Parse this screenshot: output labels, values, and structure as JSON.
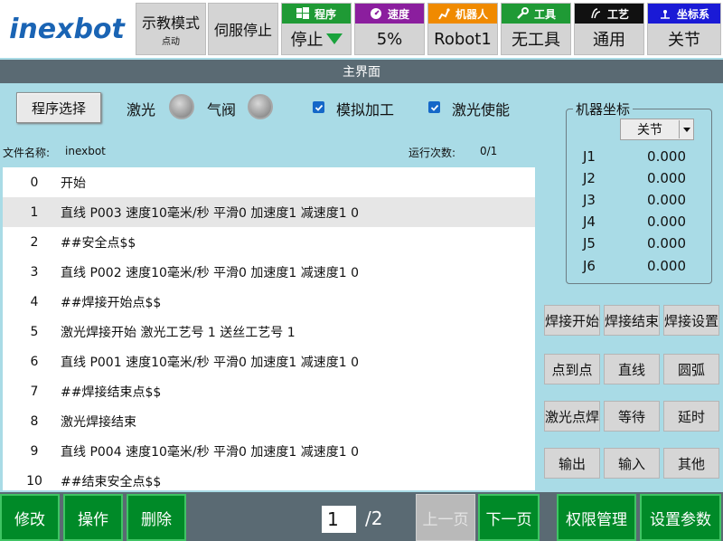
{
  "header": {
    "logo_text": "inexbot",
    "mode": {
      "label": "示教模式",
      "sub": "点动"
    },
    "servo_label": "伺服停止",
    "statuses": [
      {
        "label": "程序",
        "value": "停止",
        "color": "#1f9a35",
        "icon": "windows-grid-icon"
      },
      {
        "label": "速度",
        "value": "5%",
        "color": "#8b1e9e",
        "icon": "speed-gauge-icon"
      },
      {
        "label": "机器人",
        "value": "Robot1",
        "color": "#f08a00",
        "icon": "robot-arm-icon"
      },
      {
        "label": "工具",
        "value": "无工具",
        "color": "#1f9a35",
        "icon": "wrench-icon"
      },
      {
        "label": "工艺",
        "value": "通用",
        "color": "#111111",
        "icon": "process-icon"
      },
      {
        "label": "坐标系",
        "value": "关节",
        "color": "#1a1ad6",
        "icon": "coordinate-icon"
      }
    ]
  },
  "title": "主界面",
  "controls": {
    "program_select": "程序选择",
    "laser_label": "激光",
    "valve_label": "气阀",
    "simulate_label": "模拟加工",
    "laser_enable_label": "激光使能"
  },
  "file": {
    "name_label": "文件名称:",
    "name_value": "inexbot",
    "runs_label": "运行次数:",
    "runs_value": "0/1"
  },
  "program_lines": [
    {
      "num": "0",
      "text": "开始"
    },
    {
      "num": "1",
      "text": "直线 P003 速度10毫米/秒  平滑0 加速度1 减速度1 0"
    },
    {
      "num": "2",
      "text": "##安全点$$"
    },
    {
      "num": "3",
      "text": "直线 P002 速度10毫米/秒  平滑0 加速度1 减速度1 0"
    },
    {
      "num": "4",
      "text": "##焊接开始点$$"
    },
    {
      "num": "5",
      "text": "激光焊接开始 激光工艺号 1 送丝工艺号 1"
    },
    {
      "num": "6",
      "text": "直线 P001 速度10毫米/秒  平滑0 加速度1 减速度1 0"
    },
    {
      "num": "7",
      "text": "##焊接结束点$$"
    },
    {
      "num": "8",
      "text": "激光焊接结束"
    },
    {
      "num": "9",
      "text": "直线 P004 速度10毫米/秒  平滑0 加速度1 减速度1 0"
    },
    {
      "num": "10",
      "text": "##结束安全点$$"
    }
  ],
  "coords": {
    "title": "机器坐标",
    "mode": "关节",
    "joints": [
      {
        "name": "J1",
        "value": "0.000"
      },
      {
        "name": "J2",
        "value": "0.000"
      },
      {
        "name": "J3",
        "value": "0.000"
      },
      {
        "name": "J4",
        "value": "0.000"
      },
      {
        "name": "J5",
        "value": "0.000"
      },
      {
        "name": "J6",
        "value": "0.000"
      }
    ]
  },
  "functions": [
    "焊接开始",
    "焊接结束",
    "焊接设置",
    "点到点",
    "直线",
    "圆弧",
    "激光点焊",
    "等待",
    "延时",
    "输出",
    "输入",
    "其他"
  ],
  "bottom": {
    "modify": "修改",
    "operate": "操作",
    "delete": "删除",
    "page": "1",
    "total": "/2",
    "prev": "上一页",
    "next": "下一页",
    "permissions": "权限管理",
    "settings": "设置参数"
  }
}
